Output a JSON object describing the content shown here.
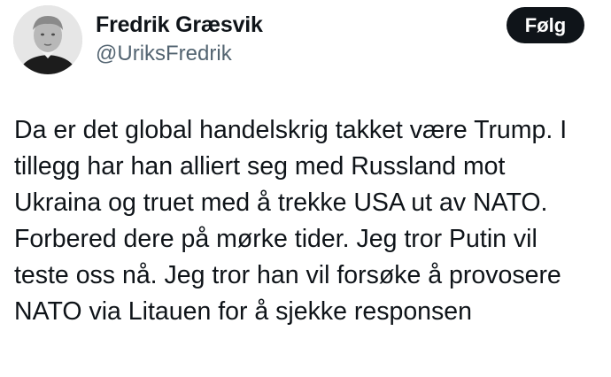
{
  "author": {
    "display_name": "Fredrik Græsvik",
    "handle": "@UriksFredrik",
    "avatar_icon": "person-portrait-avatar"
  },
  "follow_button": {
    "label": "Følg"
  },
  "tweet": {
    "lines": [
      "Da er det global handelskrig takket være Trump. I",
      "tillegg har han alliert seg med Russland mot",
      "Ukraina og truet med å trekke USA ut av NATO.",
      "Forbered dere på mørke tider. Jeg tror Putin vil",
      "teste oss nå. Jeg tror han vil forsøke å provosere",
      "NATO via Litauen for å sjekke responsen"
    ]
  },
  "colors": {
    "text_primary": "#0f1419",
    "text_secondary": "#536471",
    "button_bg": "#0f1419",
    "button_text": "#ffffff"
  }
}
